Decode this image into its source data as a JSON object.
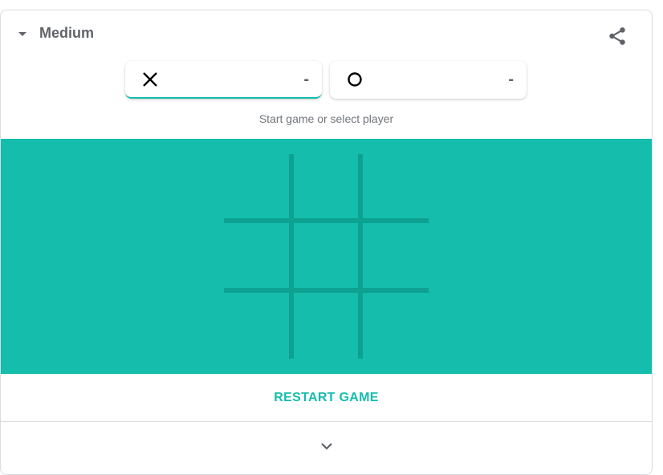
{
  "header": {
    "difficulty": "Medium",
    "share_icon": "share-icon",
    "caret_icon": "caret-down-icon"
  },
  "players": [
    {
      "mark": "X",
      "icon": "x-mark-icon",
      "score": "-",
      "active": true
    },
    {
      "mark": "O",
      "icon": "o-mark-icon",
      "score": "-",
      "active": false
    }
  ],
  "status": "Start game or select player",
  "board": {
    "cells": [
      "",
      "",
      "",
      "",
      "",
      "",
      "",
      "",
      ""
    ],
    "background": "#14bdac",
    "line_color": "#0da192"
  },
  "restart_label": "RESTART GAME",
  "expand_icon": "chevron-down-icon",
  "colors": {
    "accent": "#14bdac",
    "text_secondary": "#5f6368"
  }
}
